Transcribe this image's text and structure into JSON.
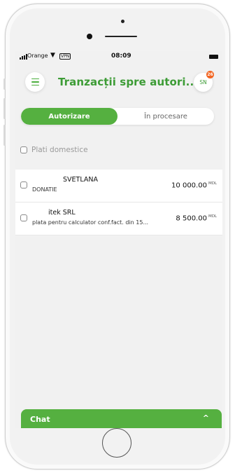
{
  "status_bar": {
    "carrier": "Orange",
    "vpn": "VPN",
    "time": "08:09"
  },
  "header": {
    "title": "Tranzacții spre autori...",
    "avatar_initials": "SN",
    "badge_count": "26"
  },
  "tabs": [
    {
      "label": "Autorizare",
      "active": true
    },
    {
      "label": "În procesare",
      "active": false
    }
  ],
  "section": {
    "label": "Plati domestice"
  },
  "transactions": [
    {
      "name": "SVETLANA",
      "description": "DONATIE",
      "amount": "10 000.00",
      "currency": "MDL"
    },
    {
      "name": "itek SRL",
      "description": "plata pentru calculator conf.fact. din 15...",
      "amount": "8 500.00",
      "currency": "MDL"
    }
  ],
  "chat": {
    "label": "Chat",
    "caret": "^"
  },
  "colors": {
    "accent": "#55b040",
    "title_green": "#3d9c36",
    "badge": "#f26522"
  }
}
